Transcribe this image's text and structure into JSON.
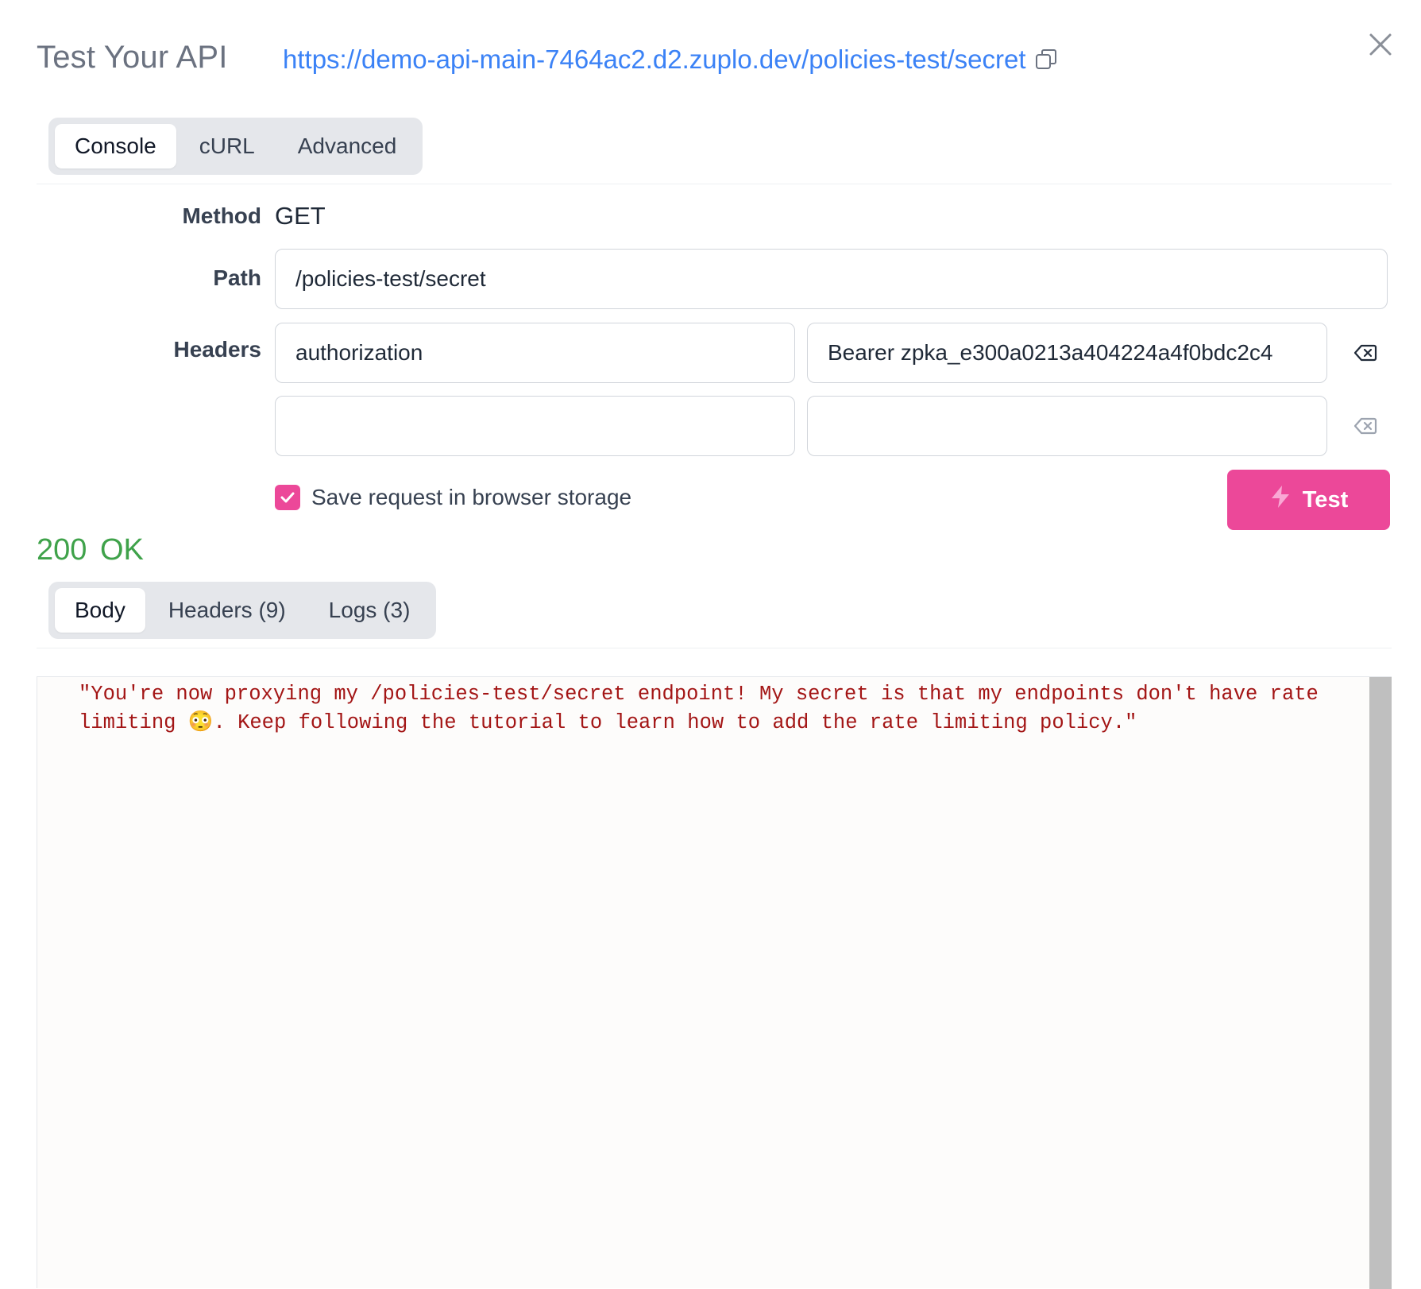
{
  "header": {
    "title": "Test Your API",
    "url": "https://demo-api-main-7464ac2.d2.zuplo.dev/policies-test/secret",
    "copy_icon": "copy-icon",
    "close_icon": "close-icon"
  },
  "mode_tabs": [
    {
      "label": "Console",
      "active": true
    },
    {
      "label": "cURL",
      "active": false
    },
    {
      "label": "Advanced",
      "active": false
    }
  ],
  "form": {
    "method_label": "Method",
    "method_value": "GET",
    "path_label": "Path",
    "path_value": "/policies-test/secret",
    "headers_label": "Headers",
    "headers": [
      {
        "key": "authorization",
        "value": "Bearer zpka_e300a0213a404224a4f0bdc2c4"
      },
      {
        "key": "",
        "value": ""
      }
    ],
    "save_label": "Save request in browser storage",
    "save_checked": true,
    "test_button_label": "Test"
  },
  "response": {
    "status": "200 OK",
    "tabs": [
      {
        "label": "Body",
        "active": true
      },
      {
        "label": "Headers (9)",
        "active": false
      },
      {
        "label": "Logs (3)",
        "active": false
      }
    ],
    "body": "\"You're now proxying my /policies-test/secret endpoint! My secret is that my endpoints don't have rate\nlimiting 😳. Keep following the tutorial to learn how to add the rate limiting policy.\""
  },
  "colors": {
    "accent": "#ec4899",
    "link": "#3b82f6",
    "status_ok": "#3fa24a",
    "code_string": "#a31515"
  }
}
